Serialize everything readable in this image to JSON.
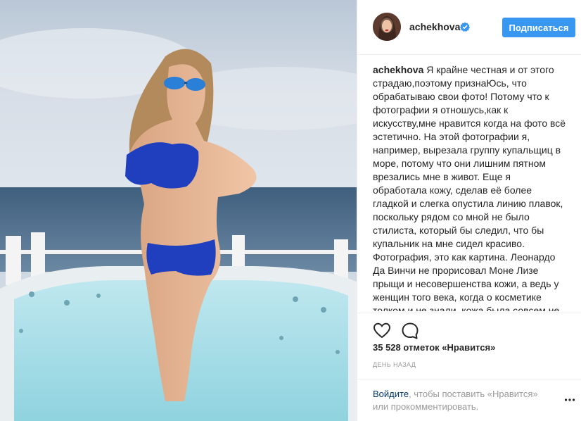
{
  "header": {
    "username": "achekhova",
    "verified_icon": "verified-badge-icon",
    "follow_label": "Подписаться",
    "accent": "#3897f0"
  },
  "caption": {
    "username": "achekhova",
    "text": "Я крайне честная и от этого страдаю,поэтому признаЮсь, что обрабатываю свои фото! Потому что к фотографии я отношусь,как к искусству,мне нравится когда на фото всё эстетично. На этой фотографии я, например, вырезала группу купальщиц в море, потому что они лишним пятном врезались мне в живот. Еще я обработала кожу, сделав её более гладкой и слегка опустила линию плавок, поскольку рядом со мной не было стилиста, который бы следил, что бы купальник на мне сидел красиво. Фотография, это как картина. Леонардо Да Винчи не прорисовал Моне Лизе прыщи и несовершенства кожи, а ведь у женщин того века, когда о косметике толком и не знали, кожа была совсем не ахти! Художники на холсте всегда"
  },
  "actions": {
    "like_icon": "heart-icon",
    "comment_icon": "comment-icon"
  },
  "likes": "35 528 отметок «Нравится»",
  "timestamp": "ДЕНЬ НАЗАД",
  "comment_box": {
    "login_link": "Войдите",
    "prompt_rest": ", чтобы поставить «Нравится» или прокомментировать.",
    "more_icon": "more-options-icon"
  }
}
